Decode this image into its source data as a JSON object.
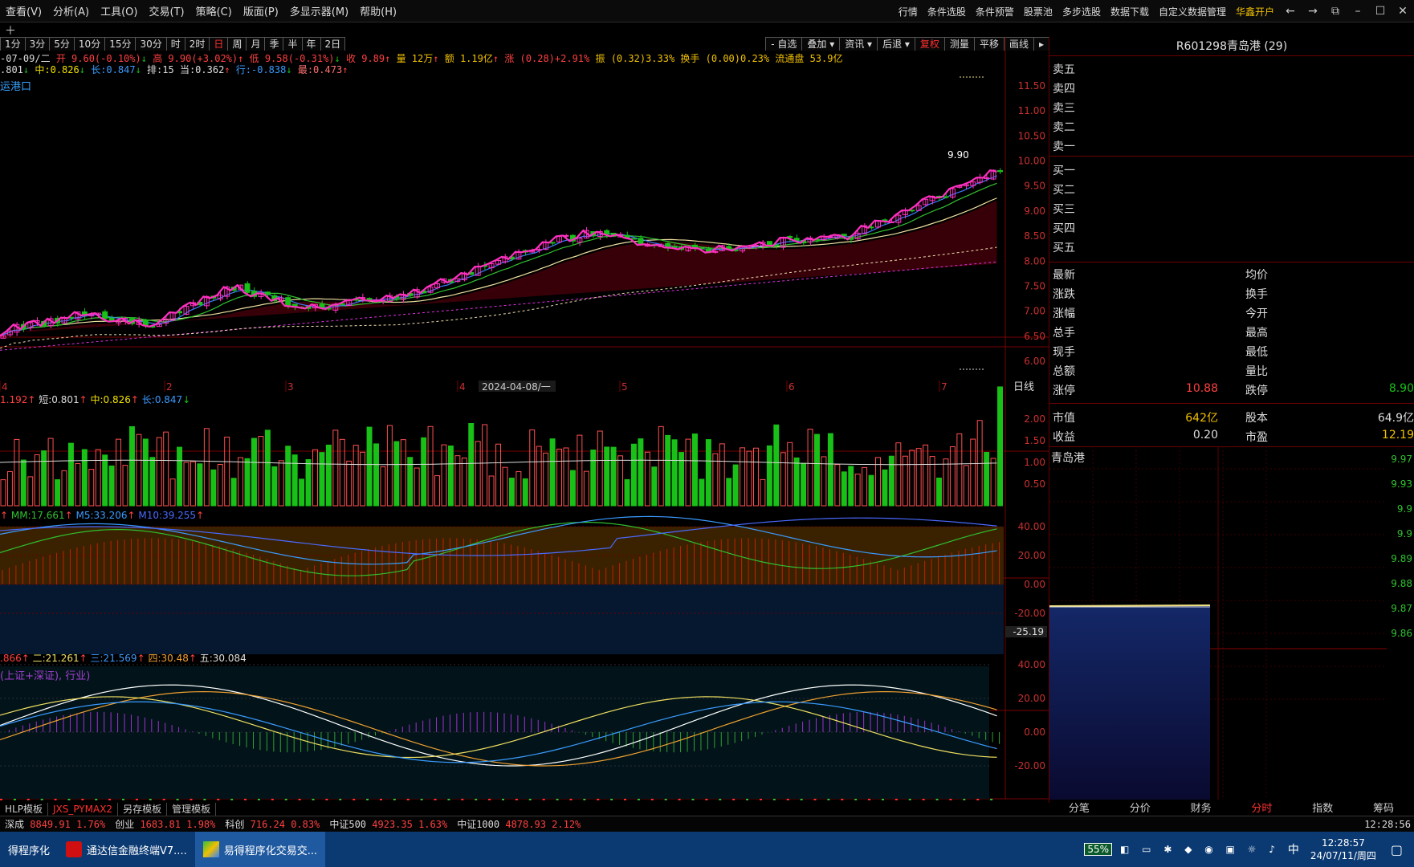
{
  "menu": {
    "items": [
      "查看(V)",
      "分析(A)",
      "工具(O)",
      "交易(T)",
      "策略(C)",
      "版面(P)",
      "多显示器(M)",
      "帮助(H)"
    ],
    "right_items": [
      "行情",
      "条件选股",
      "条件预警",
      "股票池",
      "多步选股",
      "数据下载",
      "自定义数据管理"
    ],
    "open_account": "华鑫开户",
    "back_icon": "arrow-left-icon",
    "forward_icon": "arrow-right-icon"
  },
  "toolbar2": {
    "plus": "＋"
  },
  "periods": [
    "1分",
    "3分",
    "5分",
    "10分",
    "15分",
    "30分",
    "时",
    "2时",
    "日",
    "周",
    "月",
    "季",
    "半",
    "年",
    "2日"
  ],
  "active_period": "日",
  "right_tools": [
    "- 自选",
    "叠加",
    "资讯",
    "后退",
    "复权",
    "测量",
    "平移",
    "画线"
  ],
  "info": {
    "date": "-07-09/二",
    "open": "开 9.60(-0.10%)",
    "high": "高 9.90(+3.02%)",
    "low": "低 9.58(-0.31%)",
    "close": "收 9.89",
    "vol": "量 12万",
    "amount": "额 1.19亿",
    "change": "涨 (0.28)+2.91%",
    "amplitude": "振 (0.32)3.33%",
    "turnover": "换手 (0.00)0.23%",
    "float": "流通盘 53.9亿"
  },
  "info2": {
    "a": ".801",
    "mid": "中:0.826",
    "long": "长:0.847",
    "rank": "排:15",
    "cur": "当:0.362",
    "hang": "行:-0.838",
    "max": "最:0.473"
  },
  "stock_label": "运港口",
  "price_axis": [
    "11.50",
    "11.00",
    "10.50",
    "10.00",
    "9.50",
    "9.00",
    "8.50",
    "8.00",
    "7.50",
    "7.00",
    "6.50",
    "6.00"
  ],
  "price_tag": "9.90",
  "date_axis": [
    "4",
    "2",
    "3",
    "4",
    "2024-04-08/一",
    "5",
    "6",
    "7"
  ],
  "daily_label": "日线",
  "vol_info": {
    "a": "1.192",
    "short": "短:0.801",
    "mid": "中:0.826",
    "long": "长:0.847"
  },
  "vol_axis": [
    "2.00",
    "1.50",
    "1.00",
    "0.50"
  ],
  "osc1_info": {
    "mm": "MM:17.661",
    "m5": "M5:33.206",
    "m10": "M10:39.255"
  },
  "osc1_axis": [
    "40.00",
    "20.00",
    "0.00",
    "-20.00"
  ],
  "osc1_cursor": "-25.19",
  "osc2_info": {
    "one": ".866",
    "two": "二:21.261",
    "three": "三:21.569",
    "four": "四:30.48",
    "five": "五:30.084"
  },
  "osc2_note": "(上证+深证), 行业)",
  "osc2_axis": [
    "40.00",
    "20.00",
    "0.00",
    "-20.00"
  ],
  "right_panel": {
    "title": "R601298青岛港  (29)",
    "sells": [
      "卖五",
      "卖四",
      "卖三",
      "卖二",
      "卖一"
    ],
    "buys": [
      "买一",
      "买二",
      "买三",
      "买四",
      "买五"
    ],
    "left_labels": [
      "最新",
      "涨跌",
      "涨幅",
      "总手",
      "现手",
      "总额",
      "涨停"
    ],
    "right_labels": [
      "均价",
      "换手",
      "今开",
      "最高",
      "最低",
      "量比",
      "跌停"
    ],
    "limit_up": "10.88",
    "limit_down": "8.90",
    "mcap_label": "市值",
    "mcap": "642亿",
    "shares_label": "股本",
    "shares": "64.9亿",
    "eps_label": "收益",
    "eps": "0.20",
    "pe_label": "市盈",
    "pe": "12.19",
    "mini_name": "青岛港",
    "mini_axis": [
      "9.97",
      "9.93",
      "9.9",
      "9.9",
      "9.89",
      "9.88",
      "9.87",
      "9.86"
    ],
    "tabs": [
      "分笔",
      "分价",
      "财务",
      "分时",
      "指数",
      "筹码"
    ],
    "active_tab": "分时"
  },
  "template_bar": [
    "HLP模板",
    "JXS_PYMAX2",
    "另存模板",
    "管理模板"
  ],
  "status": [
    {
      "name": "深成",
      "val": "8849.91",
      "pct": "1.76%"
    },
    {
      "name": "创业",
      "val": "1683.81",
      "pct": "1.98%"
    },
    {
      "name": "科创",
      "val": "716.24",
      "pct": "0.83%"
    },
    {
      "name": "中证500",
      "val": "4923.35",
      "pct": "1.63%"
    },
    {
      "name": "中证1000",
      "val": "4878.93",
      "pct": "2.12%"
    }
  ],
  "status_time": "12:28:56",
  "taskbar": {
    "tasks": [
      "得程序化",
      "通达信金融终端V7....",
      "易得程序化交易交..."
    ],
    "battery": "55%",
    "ime": "中",
    "time": "12:28:57",
    "date": "24/07/11/周四"
  },
  "colors": {
    "up": "#ff3b3b",
    "down": "#18b418",
    "magenta": "#ff30c0",
    "yellow": "#f0e080",
    "blue": "#3a7bff",
    "bg": "#000000",
    "axis": "#cc3030"
  }
}
